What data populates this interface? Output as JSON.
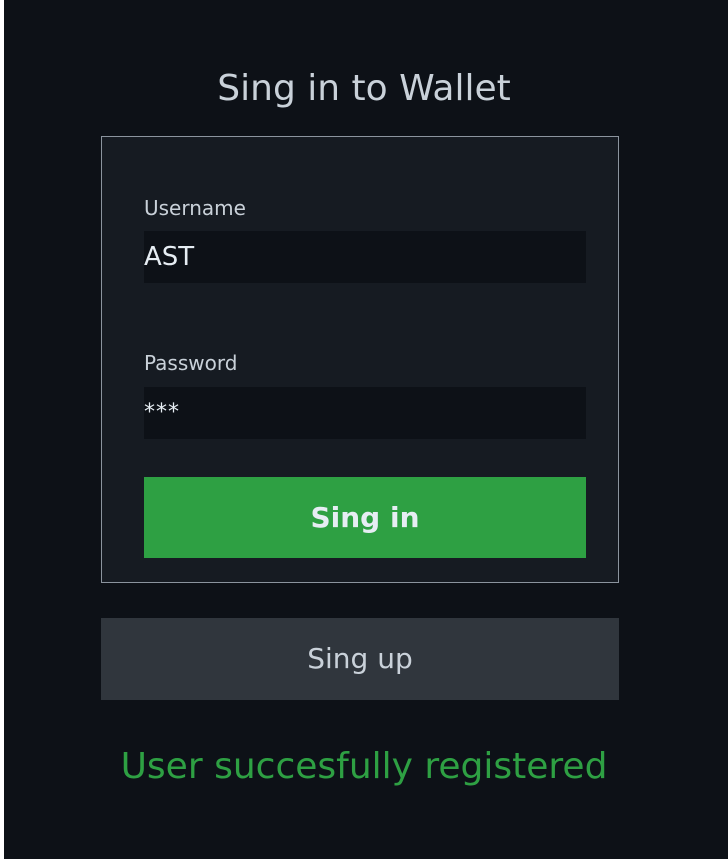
{
  "colors": {
    "background": "#0d1117",
    "panel": "#161b22",
    "panel_border": "#8b949e",
    "input_background": "#0d1117",
    "primary_button": "#2ea043",
    "secondary_button": "#30363d",
    "success_text": "#2ea043",
    "text": "#c9d1d9"
  },
  "login": {
    "title": "Sing in to Wallet",
    "username": {
      "label": "Username",
      "value": "AST"
    },
    "password": {
      "label": "Password",
      "value": "***"
    },
    "signin_label": "Sing in"
  },
  "signup_label": "Sing up",
  "status_message": "User succesfully registered"
}
